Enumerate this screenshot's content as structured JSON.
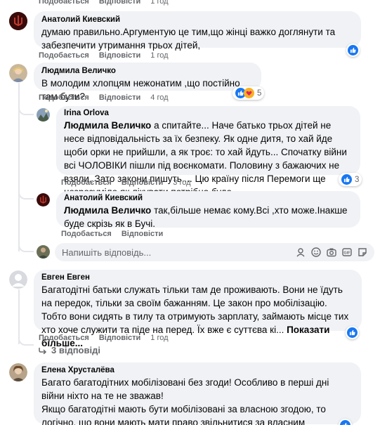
{
  "top_actions": {
    "like": "Подобається",
    "reply": "Відповісти",
    "time": "1 год"
  },
  "comments": [
    {
      "author": "Анатолий Киевский",
      "text": "думаю правильно.Аргументую це тим,що жінці важко доглянути та забезпечити утримання трьох дітей,",
      "like": "Подобається",
      "reply": "Відповісти",
      "time": "1 год"
    },
    {
      "author": "Людмила Величко",
      "text": "В молодим хлопцям нежонатим ,що постійно там бути?",
      "like": "Подобається",
      "reply": "Відповісти",
      "time": "4 год",
      "reactions": "5",
      "replies": [
        {
          "author": "Irina Orlova",
          "mention": "Людмила Величко",
          "text": " а спитайте... Наче батько трьох дітей не несе відповідальність за їх безпеку. Як одне дитя, то хай йде щоби орки не прийшли, а як троє: то хай йдуть... Спочатку війни всі ЧОЛОВІКИ пішли під воєнкомати. Половину з бажаючих не взяли. Зато закони пишуть.... Цю країну після Перемоги ще незрозуміло як лікувати потрібно буде....",
          "like": "Подобається",
          "reply": "Відповісти",
          "time": "3 год",
          "reactions": "3"
        },
        {
          "author": "Анатолий Киевский",
          "mention": "Людмила Величко",
          "text": " так,більше немає кому.Всі ,хто може.Інакше буде скрізь як в Бучі.",
          "like": "Подобається",
          "reply": "Відповісти"
        }
      ],
      "reply_input_placeholder": "Напишіть відповідь..."
    },
    {
      "author": "Евген Евген",
      "text": "Багатодітні батьки служать тільки там де проживають. Вони не їдуть на передок, тільки за своїм бажанням. Це закон про мобілізацію. Тобто вони сидять в тилу та отримують зарплату, займають місце тих хто хоче служити та піде на перед. Їх вже є суттєва кі... ",
      "see_more": "Показати більше...",
      "like": "Подобається",
      "reply": "Відповісти",
      "time": "1 год",
      "replies_link": "3 відповіді"
    },
    {
      "author": "Елена Хрусталёва",
      "text": "Багато багатодітних мобілізовані без згоди! Особливо в перші дні війни ніхто на те не зважав!\nЯкщо багатодітні мають бути мобілізовані за власною згодою, то логічно, що вони мають мати право звільнитися за власним бажанням."
    }
  ],
  "colors": {
    "bubble": "#f0f2f5",
    "like_blue": "#1877f2",
    "meta_gray": "#65676b"
  }
}
